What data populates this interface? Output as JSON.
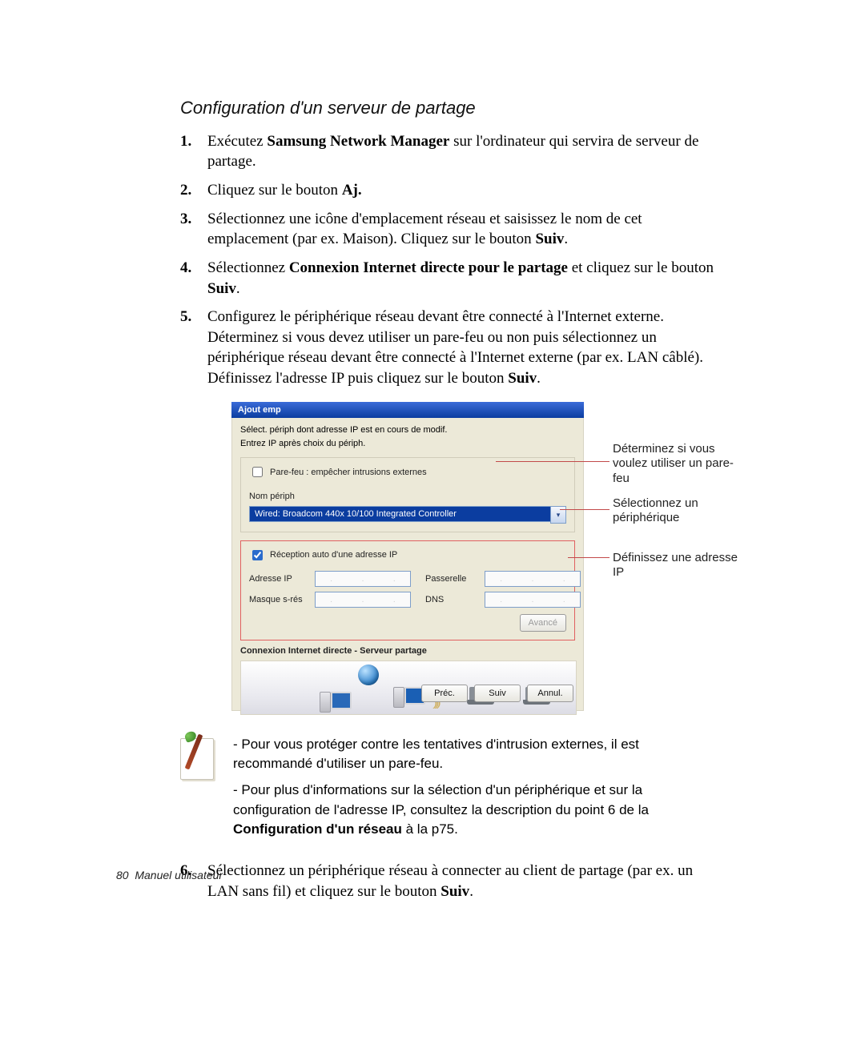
{
  "section": {
    "title": "Configuration d'un serveur de partage"
  },
  "steps": {
    "s1": {
      "num": "1.",
      "pre": "Exécutez ",
      "bold": "Samsung Network Manager",
      "post": " sur l'ordinateur qui servira de serveur de partage."
    },
    "s2": {
      "num": "2.",
      "pre": "Cliquez sur le bouton ",
      "bold": "Aj.",
      "post": ""
    },
    "s3": {
      "num": "3.",
      "text": "Sélectionnez une icône d'emplacement réseau et saisissez le nom de cet emplacement (par ex. Maison). Cliquez sur le bouton ",
      "bold": "Suiv",
      "post": "."
    },
    "s4": {
      "num": "4.",
      "pre": "Sélectionnez ",
      "bold": "Connexion Internet directe pour le partage",
      "post": " et cliquez sur le bouton ",
      "bold2": "Suiv",
      "post2": "."
    },
    "s5": {
      "num": "5.",
      "text": "Configurez le périphérique réseau devant être connecté à l'Internet externe. Déterminez si vous devez utiliser un pare-feu ou non puis sélectionnez un périphérique réseau devant être connecté à l'Internet externe (par ex. LAN câblé). Définissez l'adresse IP puis cliquez sur le bouton ",
      "bold": "Suiv",
      "post": "."
    },
    "s6": {
      "num": "6.",
      "text": "Sélectionnez un périphérique réseau à connecter au client de partage (par ex. un LAN sans fil) et cliquez sur le bouton ",
      "bold": "Suiv",
      "post": "."
    }
  },
  "dialog": {
    "title": "Ajout emp",
    "instr1": "Sélect. périph dont adresse IP est en cours de modif.",
    "instr2": "Entrez IP après choix du périph.",
    "firewall_label": "Pare-feu : empêcher intrusions externes",
    "device_label": "Nom périph",
    "device_value": "Wired: Broadcom 440x 10/100 Integrated Controller",
    "autoip_label": "Réception auto d'une adresse IP",
    "ip_label": "Adresse IP",
    "mask_label": "Masque s-rés",
    "gateway_label": "Passerelle",
    "dns_label": "DNS",
    "advanced": "Avancé",
    "diagram_title": "Connexion Internet directe - Serveur partage",
    "btn_prev": "Préc.",
    "btn_next": "Suiv",
    "btn_cancel": "Annul."
  },
  "callouts": {
    "c1": "Déterminez si vous voulez utiliser un pare-feu",
    "c2": "Sélectionnez un périphérique",
    "c3": "Définissez une adresse IP"
  },
  "note": {
    "p1": "- Pour vous protéger contre les tentatives d'intrusion externes, il est recommandé d'utiliser un pare-feu.",
    "p2_pre": "- Pour plus d'informations sur la sélection d'un périphérique et sur la configuration de l'adresse IP, consultez la description du point 6 de la ",
    "p2_bold": "Configuration d'un réseau",
    "p2_post": " à la p75."
  },
  "footer": {
    "page": "80",
    "label": "Manuel utilisateur"
  }
}
